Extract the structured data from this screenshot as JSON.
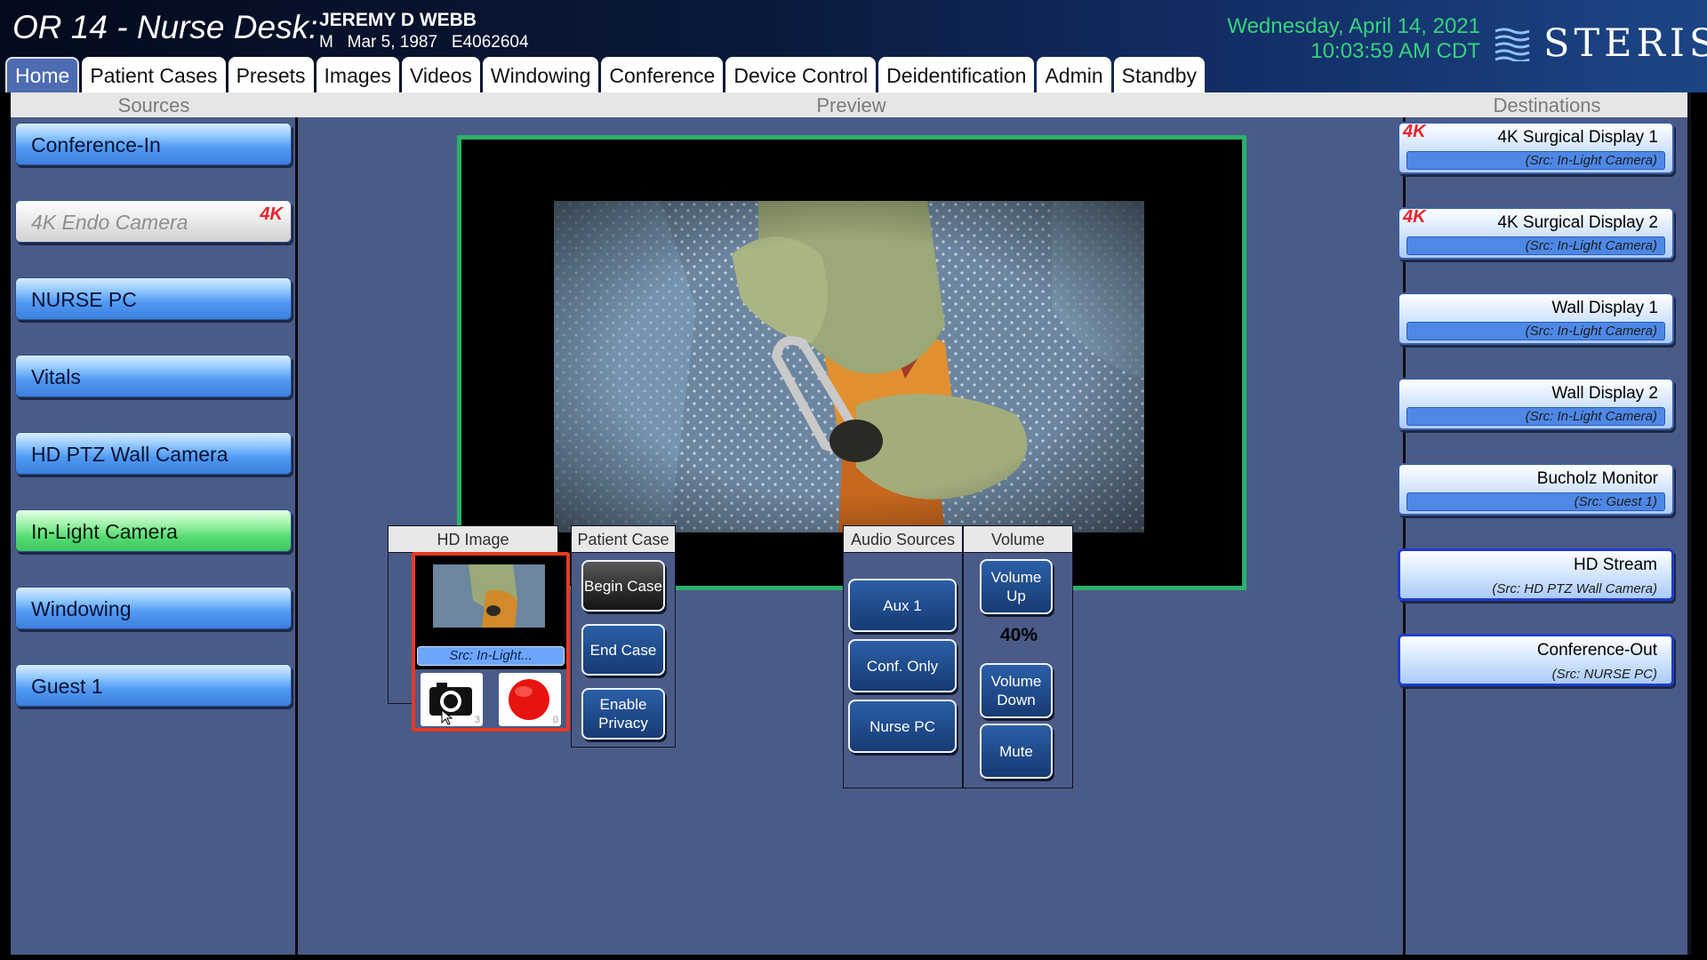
{
  "header": {
    "title": "OR 14 - Nurse Desk:",
    "patient_name": "JEREMY D WEBB",
    "patient_meta": "M   Mar 5, 1987   E4062604",
    "date": "Wednesday, April 14, 2021",
    "time": "10:03:59 AM CDT",
    "brand": "STERIS"
  },
  "tabs": [
    {
      "label": "Home",
      "active": true
    },
    {
      "label": "Patient Cases"
    },
    {
      "label": "Presets"
    },
    {
      "label": "Images"
    },
    {
      "label": "Videos"
    },
    {
      "label": "Windowing"
    },
    {
      "label": "Conference"
    },
    {
      "label": "Device Control"
    },
    {
      "label": "Deidentification"
    },
    {
      "label": "Admin"
    },
    {
      "label": "Standby"
    }
  ],
  "columns": {
    "sources": "Sources",
    "preview": "Preview",
    "destinations": "Destinations"
  },
  "sources": [
    {
      "label": "Conference-In",
      "state": "normal"
    },
    {
      "label": "4K Endo Camera",
      "state": "disabled",
      "badge": "4K"
    },
    {
      "label": "NURSE PC",
      "state": "normal"
    },
    {
      "label": "Vitals",
      "state": "normal"
    },
    {
      "label": "HD PTZ Wall Camera",
      "state": "normal"
    },
    {
      "label": "In-Light Camera",
      "state": "selected"
    },
    {
      "label": "Windowing",
      "state": "normal"
    },
    {
      "label": "Guest 1",
      "state": "normal"
    }
  ],
  "capture": {
    "header": "HD Image Capture/Record",
    "source_label": "Src: In-Light...",
    "snapshot_icon": "camera-icon",
    "record_icon": "record-icon",
    "snapshot_count": "3",
    "record_count": "0"
  },
  "patient_case": {
    "header": "Patient Case",
    "begin": "Begin Case",
    "end": "End Case",
    "privacy": "Enable Privacy"
  },
  "audio": {
    "header": "Audio Sources",
    "aux": "Aux 1",
    "conf": "Conf. Only",
    "nurse": "Nurse PC"
  },
  "volume": {
    "header": "Volume",
    "up": "Volume Up",
    "level": "40%",
    "down": "Volume Down",
    "mute": "Mute"
  },
  "destinations": [
    {
      "name": "4K Surgical Display 1",
      "source": "(Src: In-Light Camera)",
      "badge": "4K"
    },
    {
      "name": "4K Surgical Display 2",
      "source": "(Src: In-Light Camera)",
      "badge": "4K"
    },
    {
      "name": "Wall Display 1",
      "source": "(Src: In-Light Camera)"
    },
    {
      "name": "Wall Display 2",
      "source": "(Src: In-Light Camera)"
    },
    {
      "name": "Bucholz Monitor",
      "source": "(Src: Guest 1)"
    },
    {
      "name": "HD Stream",
      "source": "(Src: HD PTZ Wall Camera)"
    },
    {
      "name": "Conference-Out",
      "source": "(Src: NURSE PC)"
    }
  ],
  "colors": {
    "accent_green": "#36d37c",
    "preview_border": "#2ab06a",
    "record_red": "#e63a24",
    "panel_bg": "#4b5b88"
  }
}
